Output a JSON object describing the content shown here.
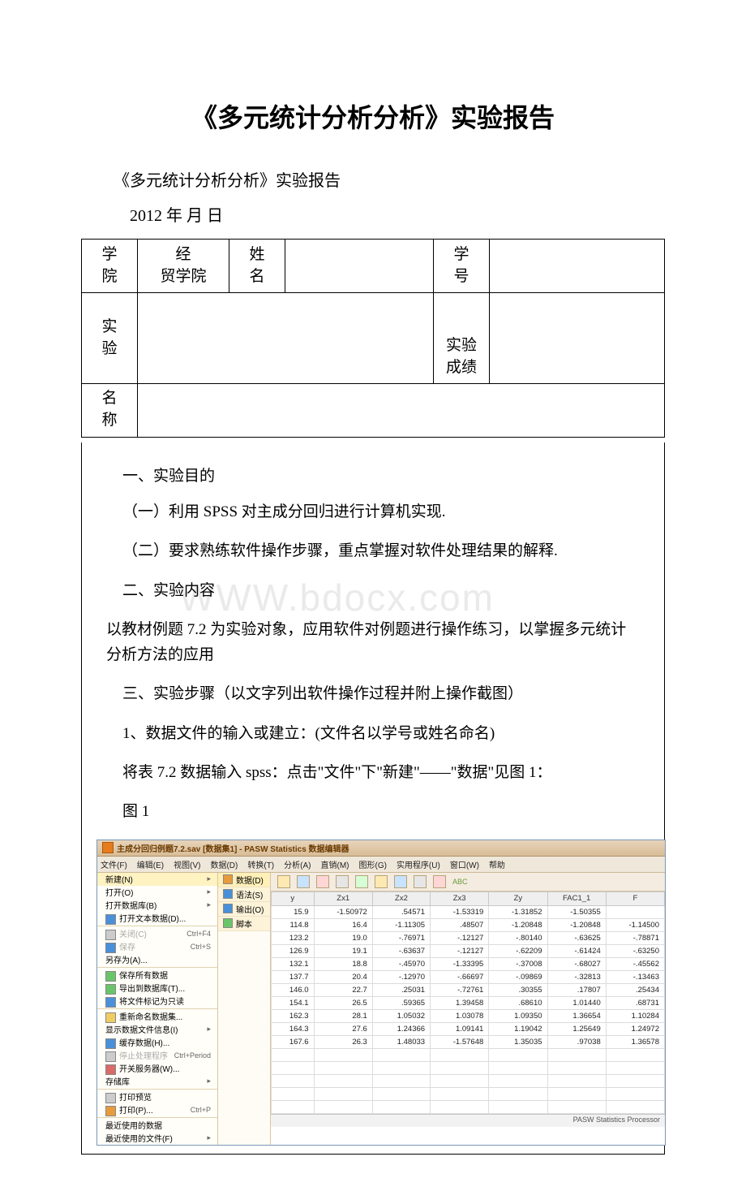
{
  "doc": {
    "title": "《多元统计分析分析》实验报告",
    "subtitle": "《多元统计分析分析》实验报告",
    "date": "2012 年  月  日",
    "table": {
      "col1": "学\n院",
      "col1_val": "经\n贸学院",
      "col2": "姓\n名",
      "col2_val": "",
      "col3": "学\n号",
      "col3_val": "",
      "row2_l1": "实\n验",
      "row2_l2": "名\n称",
      "row2_mid": "",
      "row2_right_label": "实验成绩",
      "row2_right_val": ""
    },
    "sections": {
      "s1_head": "一、实验目的",
      "s1_p1": "（一）利用 SPSS 对主成分回归进行计算机实现.",
      "s1_p2": "（二）要求熟练软件操作步骤，重点掌握对软件处理结果的解释.",
      "s2_head": "二、实验内容",
      "watermark": "WWW.bdocx.com",
      "s2_p1": "以教材例题 7.2 为实验对象，应用软件对例题进行操作练习，以掌握多元统计分析方法的应用",
      "s3_head": "三、实验步骤（以文字列出软件操作过程并附上操作截图）",
      "s3_p1": "1、数据文件的输入或建立：(文件名以学号或姓名命名)",
      "s3_p2": "将表 7.2 数据输入 spss：点击\"文件\"下\"新建\"——\"数据\"见图 1：",
      "fig_label": "图 1"
    }
  },
  "spss": {
    "title": "主成分回归例题7.2.sav [数据集1] - PASW Statistics 数据编辑器",
    "menubar": [
      "文件(F)",
      "编辑(E)",
      "视图(V)",
      "数据(D)",
      "转换(T)",
      "分析(A)",
      "直销(M)",
      "图形(G)",
      "实用程序(U)",
      "窗口(W)",
      "帮助"
    ],
    "file_menu": [
      {
        "label": "新建(N)",
        "hover": true,
        "arrow": true
      },
      {
        "label": "打开(O)",
        "arrow": true
      },
      {
        "label": "打开数据库(B)",
        "arrow": true
      },
      {
        "label": "打开文本数据(D)...",
        "icon": "ico-blue"
      },
      {
        "sep": true
      },
      {
        "label": "关闭(C)",
        "shortcut": "Ctrl+F4",
        "icon": "ico-gray",
        "disabled": true
      },
      {
        "label": "保存",
        "shortcut": "Ctrl+S",
        "icon": "ico-blue",
        "disabled": true
      },
      {
        "label": "另存为(A)..."
      },
      {
        "sep": true
      },
      {
        "label": "保存所有数据",
        "icon": "ico-green"
      },
      {
        "label": "导出到数据库(T)...",
        "icon": "ico-green"
      },
      {
        "label": "将文件标记为只读",
        "icon": "ico-blue"
      },
      {
        "sep": true
      },
      {
        "label": "重新命名数据集...",
        "icon": "ico-yellow"
      },
      {
        "label": "显示数据文件信息(I)",
        "arrow": true
      },
      {
        "label": "缓存数据(H)...",
        "icon": "ico-blue"
      },
      {
        "label": "停止处理程序",
        "shortcut": "Ctrl+Period",
        "icon": "ico-gray",
        "disabled": true
      },
      {
        "label": "开关服务器(W)...",
        "icon": "ico-red"
      },
      {
        "label": "存储库",
        "arrow": true
      },
      {
        "sep": true
      },
      {
        "label": "打印预览",
        "icon": "ico-gray"
      },
      {
        "label": "打印(P)...",
        "shortcut": "Ctrl+P",
        "icon": "ico-orange"
      },
      {
        "sep": true
      },
      {
        "label": "最近使用的数据"
      },
      {
        "label": "最近使用的文件(F)",
        "arrow": true
      }
    ],
    "new_submenu": [
      {
        "label": "数据(D)",
        "icon": "ico-orange",
        "sel": true
      },
      {
        "label": "语法(S)",
        "icon": "ico-blue"
      },
      {
        "label": "输出(O)",
        "icon": "ico-blue"
      },
      {
        "label": "脚本",
        "icon": "ico-green"
      }
    ],
    "grid": {
      "headers": [
        "y",
        "Zx1",
        "Zx2",
        "Zx3",
        "Zy",
        "FAC1_1",
        "F"
      ],
      "rows": [
        [
          "15.9",
          "-1.50972",
          ".54571",
          "-1.53319",
          "-1.31852",
          "-1.50355",
          ""
        ],
        [
          "114.8",
          "16.4",
          "-1.11305",
          ".48507",
          "-1.20848",
          "-1.20848",
          "-1.14500"
        ],
        [
          "123.2",
          "19.0",
          "-.76971",
          "-.12127",
          "-.80140",
          "-.63625",
          "-.78871"
        ],
        [
          "126.9",
          "19.1",
          "-.63637",
          "-.12127",
          "-.62209",
          "-.61424",
          "-.63250"
        ],
        [
          "132.1",
          "18.8",
          "-.45970",
          "-1.33395",
          "-.37008",
          "-.68027",
          "-.45562"
        ],
        [
          "137.7",
          "20.4",
          "-.12970",
          "-.66697",
          "-.09869",
          "-.32813",
          "-.13463"
        ],
        [
          "146.0",
          "22.7",
          ".25031",
          "-.72761",
          ".30355",
          ".17807",
          ".25434"
        ],
        [
          "154.1",
          "26.5",
          ".59365",
          "1.39458",
          ".68610",
          "1.01440",
          ".68731"
        ],
        [
          "162.3",
          "28.1",
          "1.05032",
          "1.03078",
          "1.09350",
          "1.36654",
          "1.10284"
        ],
        [
          "164.3",
          "27.6",
          "1.24366",
          "1.09141",
          "1.19042",
          "1.25649",
          "1.24972"
        ],
        [
          "167.6",
          "26.3",
          "1.48033",
          "-1.57648",
          "1.35035",
          ".97038",
          "1.36578"
        ]
      ]
    },
    "status": "PASW Statistics Processor"
  }
}
